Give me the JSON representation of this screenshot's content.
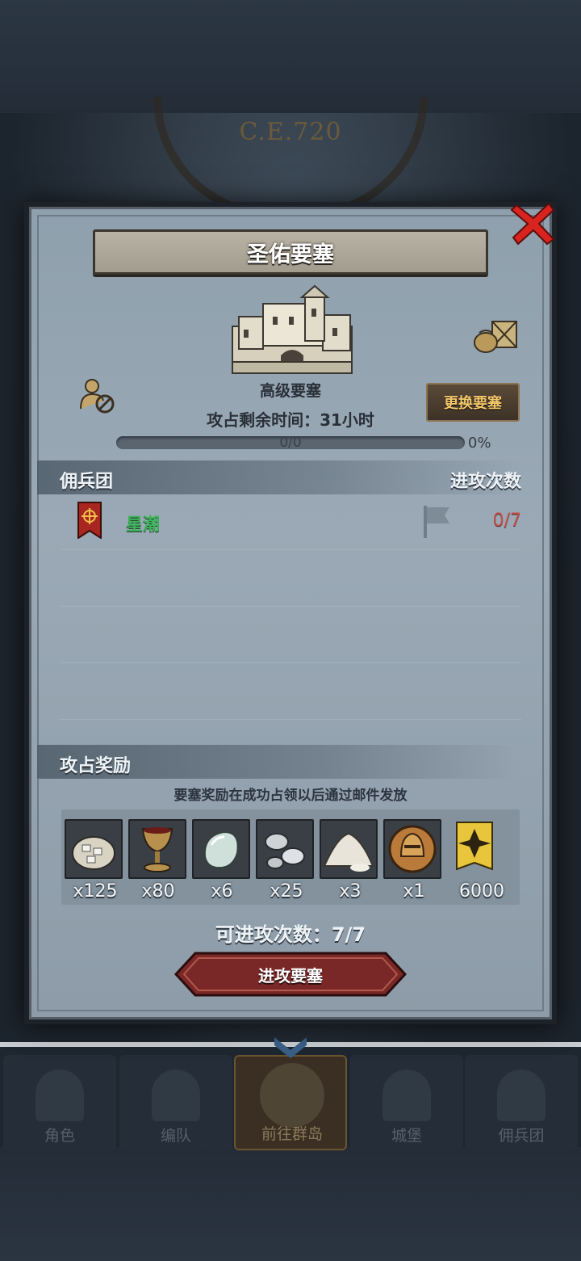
{
  "header": {
    "era_label": "C.E.720"
  },
  "modal": {
    "title": "圣佑要塞",
    "fortress_type": "高级要塞",
    "change_button": "更换要塞",
    "time_remaining": "攻占剩余时间：31小时",
    "progress": {
      "count": "0/0",
      "percent_label": "0%",
      "fraction": 0
    },
    "mercenary_section": {
      "title": "佣兵团",
      "attack_header": "进攻次数",
      "rows": [
        {
          "name": "星潮",
          "attacks": "0/7"
        }
      ]
    },
    "rewards_section": {
      "title": "攻占奖励",
      "note": "要塞奖励在成功占领以后通过邮件发放",
      "items": [
        {
          "icon": "silver-ore-sack-icon",
          "qty": "x125"
        },
        {
          "icon": "wine-goblet-icon",
          "qty": "x80"
        },
        {
          "icon": "moonstone-icon",
          "qty": "x6"
        },
        {
          "icon": "silver-ingots-icon",
          "qty": "x25"
        },
        {
          "icon": "salt-pile-icon",
          "qty": "x3"
        },
        {
          "icon": "knight-helmet-medal-icon",
          "qty": "x1"
        },
        {
          "icon": "guild-contribution-emblem-icon",
          "qty": "6000"
        }
      ]
    },
    "attacks_available": "可进攻次数：7/7",
    "attack_button": "进攻要塞"
  },
  "nav": {
    "items": [
      {
        "label": "角色"
      },
      {
        "label": "编队"
      },
      {
        "label": "前往群岛",
        "active": true
      },
      {
        "label": "城堡"
      },
      {
        "label": "佣兵团"
      }
    ]
  },
  "colors": {
    "guild_name": "#3bb55b",
    "attack_count": "#c2504a",
    "change_button_text": "#f2c66b",
    "attack_button": "#7a2727",
    "close_icon": "#d8231f"
  }
}
